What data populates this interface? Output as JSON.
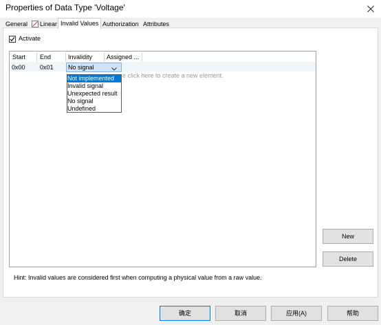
{
  "window": {
    "title": "Properties of Data Type 'Voltage'"
  },
  "tabs": [
    {
      "label": "General"
    },
    {
      "label": "Linear"
    },
    {
      "label": "Invalid Values"
    },
    {
      "label": "Authorization"
    },
    {
      "label": "Attributes"
    }
  ],
  "activate": {
    "label": "Activate",
    "checked": true
  },
  "grid": {
    "columns": [
      "Start",
      "End",
      "Invalidity",
      "Assigned ..."
    ],
    "row": {
      "start": "0x00",
      "end": "0x01",
      "invalidity": "No signal"
    },
    "placeholder": "e click here to create a new element."
  },
  "dropdown": {
    "options": [
      "Not implemented",
      "Invalid signal",
      "Unexpected result",
      "No signal",
      "Undefined"
    ],
    "highlighted": "Not implemented"
  },
  "side_buttons": {
    "new": "New",
    "delete": "Delete"
  },
  "hint": "Hint: Invalid values are considered first when computing a physical value from a raw value.",
  "bottom_buttons": {
    "ok": "确定",
    "cancel": "取消",
    "apply": "应用(A)",
    "help": "帮助"
  },
  "colors": {
    "selection": "#0078d7",
    "row_highlight": "#eef5fb",
    "combo": "#cfe3f8"
  }
}
